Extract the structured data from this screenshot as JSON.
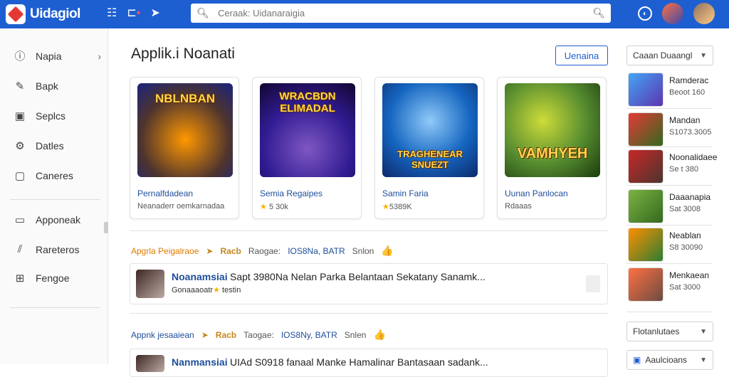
{
  "app": {
    "name": "Uidagiol"
  },
  "search": {
    "placeholder": "Ceraak: Uidanaraigia"
  },
  "sidebar": {
    "items": [
      {
        "label": "Napia",
        "icon": "info-circle-icon"
      },
      {
        "label": "Bapk",
        "icon": "pin-icon"
      },
      {
        "label": "Seplcs",
        "icon": "card-icon"
      },
      {
        "label": "Datles",
        "icon": "gear-icon"
      },
      {
        "label": "Caneres",
        "icon": "square-icon"
      },
      {
        "label": "Apponeak",
        "icon": "window-icon"
      },
      {
        "label": "Rareteros",
        "icon": "bar-chart-icon"
      },
      {
        "label": "Fengoe",
        "icon": "grid-icon"
      }
    ]
  },
  "main": {
    "title": "Applik.i Noanati",
    "primary_button": "Uenaina",
    "cards": [
      {
        "art_title": "NBLNBAN",
        "name": "Pernalfdadean",
        "meta": "Neanaderr oemkarnadaa",
        "rating": "",
        "palette": "orange"
      },
      {
        "art_title": "WRACBDN ELIMADAL",
        "name": "Semia Regaipes",
        "meta": "5 30k",
        "rating": "★",
        "palette": "purple"
      },
      {
        "art_title": "TRAGHENEAR SNUEZT",
        "name": "Samin Faria",
        "meta": "5389K",
        "rating": "★",
        "palette": "yellow"
      },
      {
        "art_title": "VAMHYEH",
        "name": "Uunan Panlocan",
        "meta": "Rdaaas",
        "rating": "",
        "palette": "green"
      }
    ],
    "sections": [
      {
        "title": "Apgrla Peigalraoe",
        "hot": "Racb",
        "pre_tag": "Raogae:",
        "tag": "IOS8Na, BATR",
        "extra": "Snlon",
        "emoji": "👍",
        "row": {
          "title": "Noanamsiai",
          "desc": "Sapt 3980Na Nelan Parka Belantaan Sekatany Sanamk...",
          "sub": "Gonaaaoatr",
          "rating": "★",
          "rating_text": "testin"
        }
      },
      {
        "title": "Appnk jesaaiean",
        "hot": "Racb",
        "pre_tag": "Taogae:",
        "tag": "IOS8Ny, BATR",
        "extra": "Snlen",
        "emoji": "👍",
        "row": {
          "title": "Nanmansiai",
          "desc": "UIAd S0918 fanaal Manke Hamalinar Bantasaan sadank...",
          "sub": "",
          "rating": "",
          "rating_text": ""
        }
      }
    ]
  },
  "rightpane": {
    "top_dropdown": "Caaan Duaangl",
    "items": [
      {
        "name": "Ramderac",
        "sub": "Beoot 160",
        "palette": "blue"
      },
      {
        "name": "Mandan",
        "sub": "S1073.3005",
        "palette": "red"
      },
      {
        "name": "Noonalidaee",
        "sub": "Se t 380",
        "palette": "red"
      },
      {
        "name": "Daaanapia",
        "sub": "Sat 3008",
        "palette": "green"
      },
      {
        "name": "Neablan",
        "sub": "S8 30090",
        "palette": "orange"
      },
      {
        "name": "Menkaean",
        "sub": "Sat 3000",
        "palette": "brown"
      }
    ],
    "bottom_dropdown_1": "Flotanlutaes",
    "bottom_dropdown_2": "Aaulcioans"
  }
}
